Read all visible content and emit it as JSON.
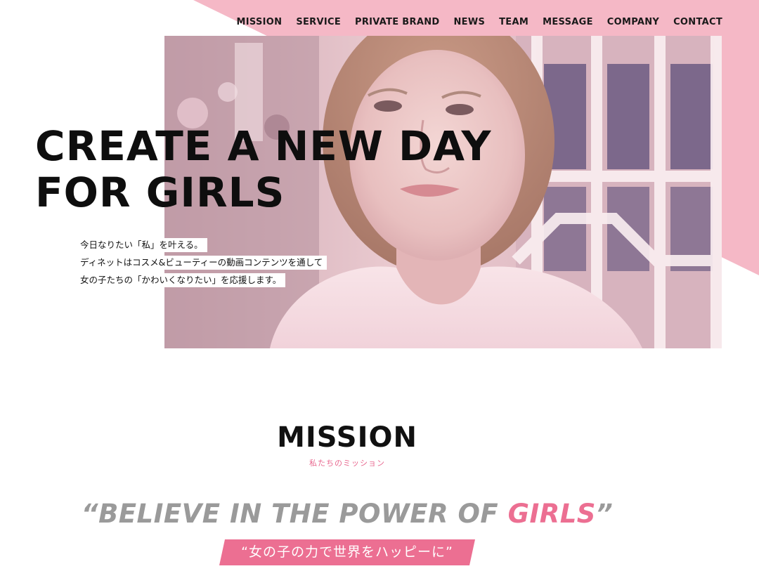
{
  "colors": {
    "pink_band": "#f5b8c6",
    "accent_pink": "#ec6f92",
    "grey_text": "#9a9a9a",
    "text_dark": "#111111"
  },
  "nav": {
    "items": [
      "MISSION",
      "SERVICE",
      "PRIVATE BRAND",
      "NEWS",
      "TEAM",
      "MESSAGE",
      "COMPANY",
      "CONTACT"
    ]
  },
  "hero": {
    "photo_desc": "hero-photo",
    "headline_line1": "CREATE A NEW DAY",
    "headline_line2": "FOR GIRLS",
    "intro_lines": [
      "今日なりたい「私」を叶える。",
      "ディネットはコスメ&ビューティーの動画コンテンツを通して",
      "女の子たちの「かわいくなりたい」を応援します。"
    ]
  },
  "mission": {
    "title": "MISSION",
    "subtitle": "私たちのミッション",
    "quote_open": "“",
    "quote_main": "BELIEVE IN THE POWER OF ",
    "quote_accent": "GIRLS",
    "quote_close": "”",
    "jp_banner": "“女の子の力で世界をハッピーに”"
  }
}
